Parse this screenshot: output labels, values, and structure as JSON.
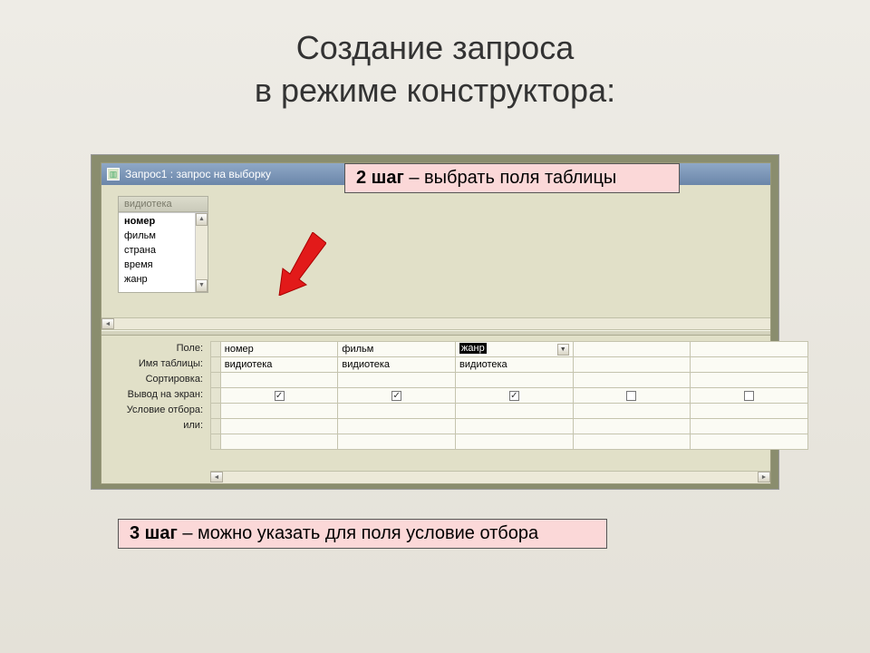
{
  "slide": {
    "title_line1": "Создание запроса",
    "title_line2": "в режиме конструктора:"
  },
  "callouts": {
    "step2_bold": "2 шаг",
    "step2_rest": " – выбрать поля таблицы",
    "step3_bold": "3 шаг",
    "step3_rest": " – можно указать для поля условие отбора"
  },
  "window": {
    "title": "Запрос1 : запрос на выборку",
    "table_name": "видиотека",
    "fields": [
      "номер",
      "фильм",
      "страна",
      "время",
      "жанр"
    ]
  },
  "grid": {
    "row_labels": {
      "field": "Поле:",
      "table": "Имя таблицы:",
      "sort": "Сортировка:",
      "show": "Вывод на экран:",
      "criteria": "Условие отбора:",
      "or": "или:"
    },
    "columns": [
      {
        "field": "номер",
        "table": "видиотека",
        "show": true,
        "highlighted": false,
        "dropdown": false
      },
      {
        "field": "фильм",
        "table": "видиотека",
        "show": true,
        "highlighted": false,
        "dropdown": false
      },
      {
        "field": "жанр",
        "table": "видиотека",
        "show": true,
        "highlighted": true,
        "dropdown": true
      },
      {
        "field": "",
        "table": "",
        "show": false,
        "highlighted": false,
        "dropdown": false
      },
      {
        "field": "",
        "table": "",
        "show": false,
        "highlighted": false,
        "dropdown": false
      }
    ]
  }
}
